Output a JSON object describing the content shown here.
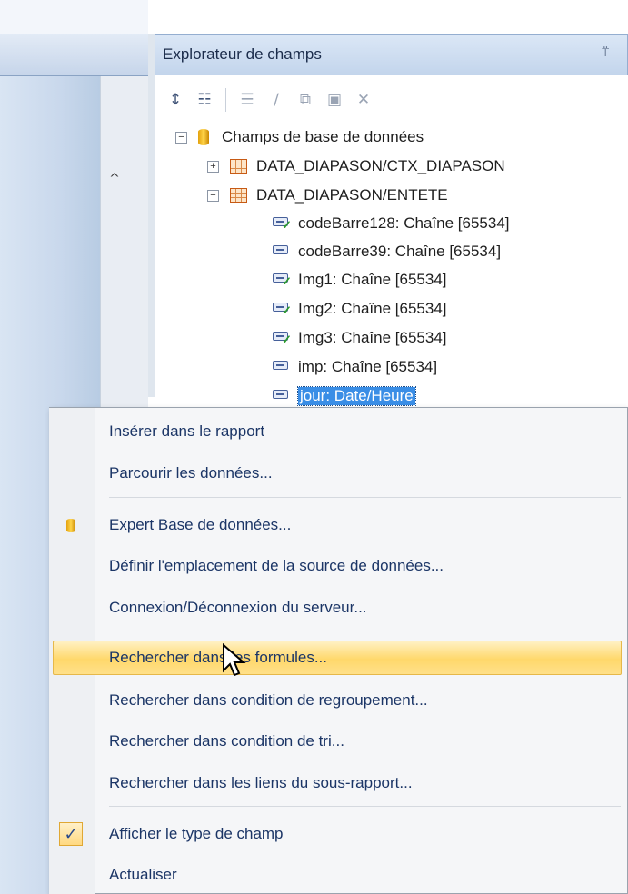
{
  "explorer": {
    "title": "Explorateur de champs",
    "pin_glyph": "⍡",
    "toolbar": [
      {
        "icon": "insert-field-icon",
        "glyph": "↕",
        "enabled": true
      },
      {
        "icon": "browse-data-icon",
        "glyph": "☷",
        "enabled": true
      },
      {
        "icon": "new-icon",
        "glyph": "☰",
        "enabled": false
      },
      {
        "icon": "edit-icon",
        "glyph": "∕",
        "enabled": false
      },
      {
        "icon": "duplicate-icon",
        "glyph": "⧉",
        "enabled": false
      },
      {
        "icon": "rename-icon",
        "glyph": "▣",
        "enabled": false
      },
      {
        "icon": "delete-icon",
        "glyph": "✕",
        "enabled": false
      }
    ],
    "tree": {
      "root": "Champs de base de données",
      "tables": [
        {
          "name": "DATA_DIAPASON/CTX_DIAPASON",
          "expanded": false
        },
        {
          "name": "DATA_DIAPASON/ENTETE",
          "expanded": true
        }
      ],
      "fields": [
        "codeBarre128: Chaîne [65534]",
        "codeBarre39: Chaîne [65534]",
        "Img1: Chaîne [65534]",
        "Img2: Chaîne [65534]",
        "Img3: Chaîne [65534]",
        "imp: Chaîne [65534]",
        "jour: Date/Heure"
      ],
      "selected_field": "jour: Date/Heure"
    }
  },
  "left_pane": {
    "scroll_up_glyph": "^"
  },
  "context_menu": {
    "items": [
      {
        "label": "Insérer dans le rapport"
      },
      {
        "label": "Parcourir les données..."
      },
      {
        "label": "Expert Base de données...",
        "icon": "database-icon"
      },
      {
        "label": "Définir l'emplacement de la source de données..."
      },
      {
        "label": "Connexion/Déconnexion du serveur..."
      },
      {
        "label": "Rechercher dans les formules...",
        "highlighted": true
      },
      {
        "label": "Rechercher dans condition de regroupement..."
      },
      {
        "label": "Rechercher dans condition de tri..."
      },
      {
        "label": "Rechercher dans les liens du sous-rapport..."
      },
      {
        "label": "Afficher le type de champ",
        "checked": true
      },
      {
        "label": "Actualiser"
      }
    ],
    "check_glyph": "✓"
  },
  "colors": {
    "menu_highlight": "#ffd86b",
    "selection": "#3a8ee6",
    "menu_text": "#1b3566"
  }
}
